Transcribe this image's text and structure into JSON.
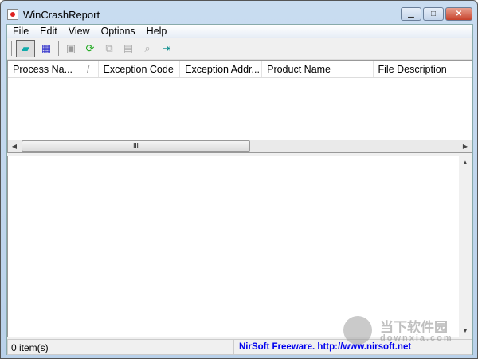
{
  "window": {
    "title": "WinCrashReport"
  },
  "menu": [
    "File",
    "Edit",
    "View",
    "Options",
    "Help"
  ],
  "toolbar": [
    "properties-icon",
    "calendar-icon",
    "save-icon",
    "refresh-icon",
    "copy-icon",
    "html-report-icon",
    "find-icon",
    "exit-icon"
  ],
  "columns": [
    "Process Na...",
    "Exception Code",
    "Exception Addr...",
    "Product Name",
    "File Description"
  ],
  "scroll_thumb": "III",
  "status": {
    "count": "0 item(s)",
    "link": "NirSoft Freeware.  http://www.nirsoft.net"
  },
  "watermark": {
    "text": "当下软件园",
    "url": "downxia.com"
  }
}
